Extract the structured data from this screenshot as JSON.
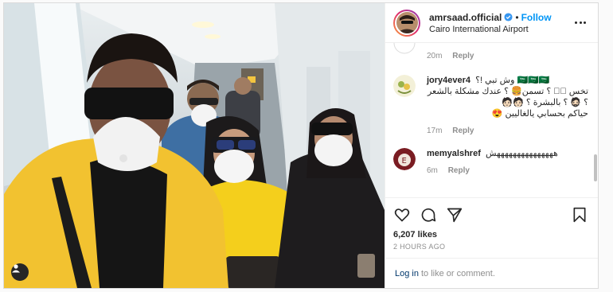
{
  "header": {
    "username": "amrsaad.official",
    "separator": "•",
    "follow_label": "Follow",
    "location": "Cairo International Airport"
  },
  "comments": [
    {
      "username": "",
      "text": "",
      "time": "20m",
      "reply_label": "Reply",
      "avatar": "partial-avatar"
    },
    {
      "username": "jory4ever4",
      "lines": [
        "وش تبي !؟ 🇸🇦🇸🇦🇸🇦",
        "تخس 🏻🏻 ؟ تسمن🍔 ؟ عندك مشكلة بالشعر",
        "؟ 🧔🏻 ؟ بالبشرة ؟ 🧑🏻🧑🏻",
        "حياكم بحسابي يالغاليين 😍"
      ],
      "time": "17m",
      "reply_label": "Reply",
      "avatar": "jory-avatar"
    },
    {
      "username": "memyalshref",
      "text": "هههههههههههههههش",
      "time": "6m",
      "reply_label": "Reply",
      "avatar": "memy-avatar"
    }
  ],
  "actions": {
    "likes": "6,207 likes",
    "time_ago": "2 HOURS AGO"
  },
  "login": {
    "link_label": "Log in",
    "rest": "to like or comment."
  },
  "colors": {
    "accent": "#0095f6",
    "verified": "#3897f0",
    "jacket": "#f2c230",
    "text_secondary": "#8e8e8e"
  }
}
